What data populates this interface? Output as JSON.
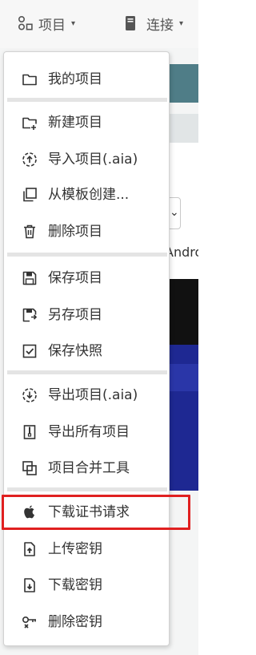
{
  "toolbar": {
    "projects_label": "项目",
    "connect_label": "连接",
    "caret": "▾"
  },
  "background": {
    "android_label": "Andro",
    "select_caret": "⌄"
  },
  "menu": {
    "my_projects": "我的项目",
    "new_project": "新建项目",
    "import_project": "导入项目(.aia)",
    "from_template": "从模板创建...",
    "delete_project": "删除项目",
    "save_project": "保存项目",
    "save_as": "另存项目",
    "save_checkpoint": "保存快照",
    "export_project": "导出项目(.aia)",
    "export_all": "导出所有项目",
    "merge_tool": "项目合并工具",
    "download_cert_request": "下载证书请求",
    "upload_keystore": "上传密钥",
    "download_keystore": "下载密钥",
    "delete_keystore": "删除密钥"
  },
  "highlight": {
    "color": "#e02020"
  }
}
